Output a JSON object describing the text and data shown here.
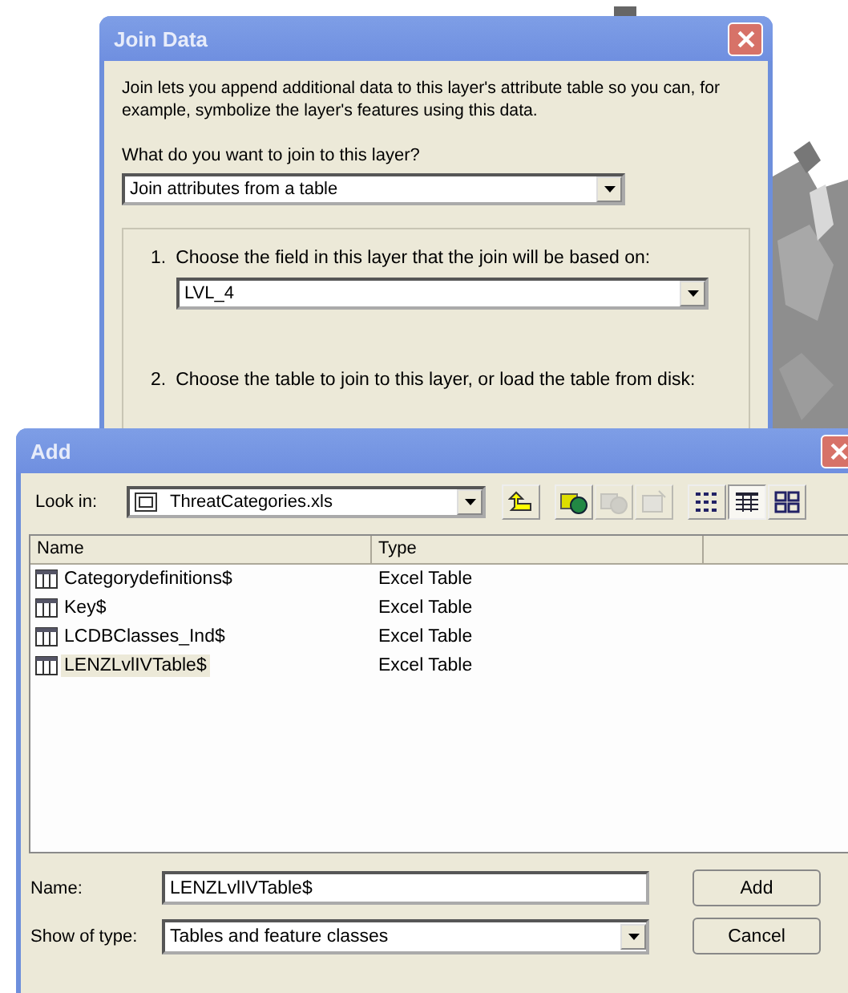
{
  "join_window": {
    "title": "Join Data",
    "intro": "Join lets you append additional data to this layer's attribute table so you can, for example, symbolize the layer's features using this data.",
    "question": "What do you want to join to this layer?",
    "join_type": "Join attributes from a table",
    "step_1": {
      "number": "1.",
      "label": "Choose the field in this layer that the join will be based on:",
      "value": "LVL_4"
    },
    "step_2": {
      "number": "2.",
      "label": "Choose the table to join to this layer, or load the table from disk:"
    }
  },
  "add_window": {
    "title": "Add",
    "look_in_label": "Look in:",
    "look_in_value": "ThreatCategories.xls",
    "toolbar": [
      {
        "kind": "up",
        "disabled": false,
        "selected": false
      },
      {
        "kind": "connect",
        "disabled": false,
        "selected": false
      },
      {
        "kind": "disconnect",
        "disabled": true,
        "selected": false
      },
      {
        "kind": "properties",
        "disabled": true,
        "selected": false
      },
      {
        "kind": "list",
        "disabled": false,
        "selected": false
      },
      {
        "kind": "details",
        "disabled": false,
        "selected": true
      },
      {
        "kind": "thumbnails",
        "disabled": false,
        "selected": false
      }
    ],
    "columns": [
      "Name",
      "Type"
    ],
    "rows": [
      {
        "name": "Categorydefinitions$",
        "type": "Excel Table",
        "selected": false
      },
      {
        "name": "Key$",
        "type": "Excel Table",
        "selected": false
      },
      {
        "name": "LCDBClasses_Ind$",
        "type": "Excel Table",
        "selected": false
      },
      {
        "name": "LENZLvlIVTable$",
        "type": "Excel Table",
        "selected": true
      }
    ],
    "name_label": "Name:",
    "name_value": "LENZLvlIVTable$",
    "type_label": "Show of type:",
    "type_value": "Tables and feature classes",
    "buttons": [
      "Add",
      "Cancel"
    ]
  }
}
